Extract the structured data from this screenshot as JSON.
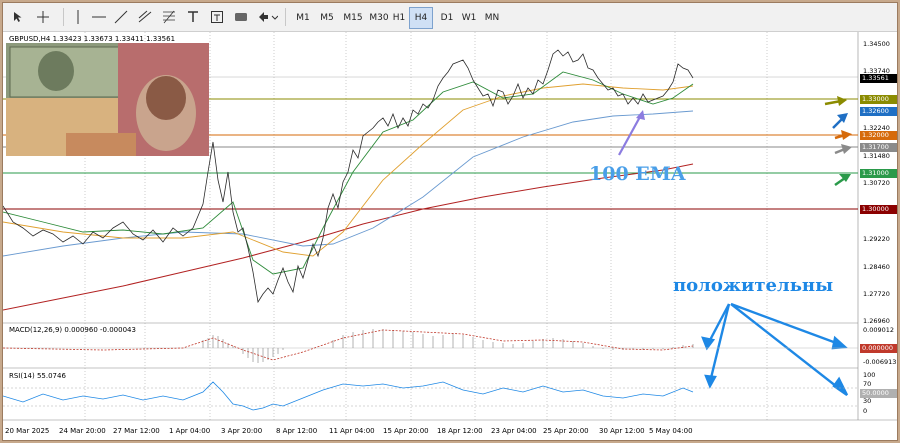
{
  "toolbar": {
    "timeframes": [
      "M1",
      "M5",
      "M15",
      "M30",
      "H1",
      "H4",
      "D1",
      "W1",
      "MN"
    ],
    "active_timeframe": "H4"
  },
  "chart": {
    "symbol_line": "GBPUSD,H4  1.33423  1.33673  1.33411  1.33561",
    "macd_label": "MACD(12,26,9) 0.000960 -0.000043",
    "rsi_label": "RSI(14) 55.0746",
    "annotation_ema": "100 EMA",
    "annotation_positive": "положительны",
    "price_ticks": [
      "1.34500",
      "1.33740",
      "1.32240",
      "1.31480",
      "1.30720",
      "1.29220",
      "1.28460",
      "1.27720",
      "1.26960"
    ],
    "macd_ticks": [
      "0.009012",
      "-0.006913"
    ],
    "macd_zero": "0.000000",
    "rsi_ticks": [
      "100",
      "70",
      "30",
      "0"
    ],
    "rsi_value": "50.0000",
    "current_price": "1.33561",
    "levels": [
      {
        "label": "1.33000",
        "color": "#8b8b00"
      },
      {
        "label": "1.32600",
        "color": "#1f6fc4"
      },
      {
        "label": "1.32000",
        "color": "#d66a0a"
      },
      {
        "label": "1.31700",
        "color": "#8a8a8a"
      },
      {
        "label": "1.31000",
        "color": "#2a9a4a"
      },
      {
        "label": "1.30000",
        "color": "#8b0000"
      }
    ],
    "dates": [
      "20 Mar 2025",
      "24 Mar 20:00",
      "27 Mar 12:00",
      "1 Apr 04:00",
      "3 Apr 20:00",
      "8 Apr 12:00",
      "11 Apr 04:00",
      "15 Apr 20:00",
      "18 Apr 12:00",
      "23 Apr 04:00",
      "25 Apr 20:00",
      "30 Apr 12:00",
      "5 May 04:00"
    ]
  }
}
